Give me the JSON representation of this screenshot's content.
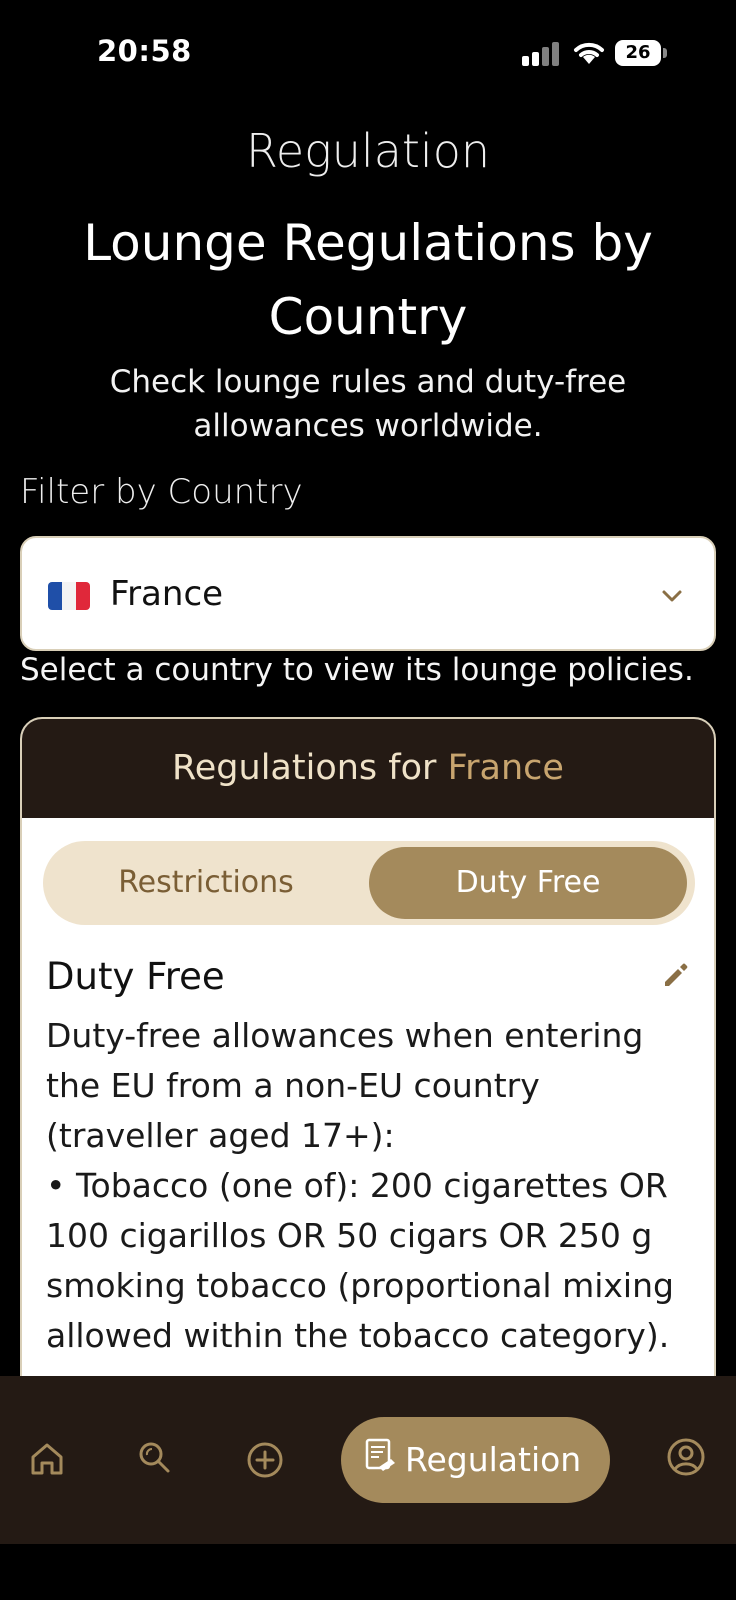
{
  "status_bar": {
    "time": "20:58",
    "battery": "26"
  },
  "page": {
    "app_title": "Regulation",
    "headline": "Lounge Regulations by Country",
    "subtitle": "Check lounge rules and duty-free allowances worldwide."
  },
  "filter": {
    "label": "Filter by Country",
    "selected_country": "France",
    "flag": "flag-france-icon",
    "helper": "Select a country to view its lounge policies."
  },
  "card": {
    "header_prefix": "Regulations for",
    "header_country": "France",
    "tabs": [
      {
        "label": "Restrictions",
        "active": false
      },
      {
        "label": "Duty Free",
        "active": true
      }
    ],
    "section_title": "Duty Free",
    "body": "Duty-free allowances when entering the EU from a non-EU country (traveller aged 17+):\n• Tobacco (one of): 200 cigarettes OR 100 cigarillos OR 50 cigars OR 250 g smoking tobacco (proportional mixing allowed within the tobacco category)."
  },
  "bottom_nav": {
    "items": [
      {
        "name": "home-icon"
      },
      {
        "name": "search-icon"
      },
      {
        "name": "add-icon"
      },
      {
        "name": "regulation-icon",
        "label": "Regulation",
        "active": true
      },
      {
        "name": "profile-icon"
      }
    ]
  },
  "colors": {
    "accent": "#a48a5c",
    "header_dark": "#241a14",
    "highlight": "#c8a56f",
    "tab_bg": "#efe3cd"
  }
}
